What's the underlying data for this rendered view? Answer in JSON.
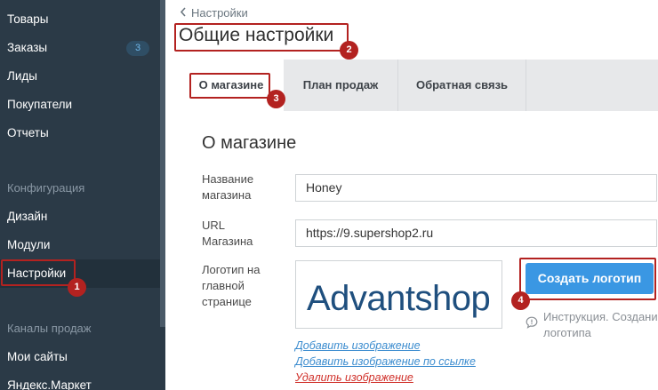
{
  "sidebar": {
    "items": [
      {
        "label": "Товары"
      },
      {
        "label": "Заказы",
        "badge": "3"
      },
      {
        "label": "Лиды"
      },
      {
        "label": "Покупатели"
      },
      {
        "label": "Отчеты"
      }
    ],
    "config_group": "Конфигурация",
    "config_items": [
      {
        "label": "Дизайн"
      },
      {
        "label": "Модули"
      },
      {
        "label": "Настройки",
        "active": true
      }
    ],
    "channels_group": "Каналы продаж",
    "channel_items": [
      {
        "label": "Мои сайты"
      },
      {
        "label": "Яндекс.Маркет"
      }
    ]
  },
  "header": {
    "breadcrumb": "Настройки",
    "title": "Общие настройки"
  },
  "tabs": [
    {
      "label": "О магазине",
      "active": true
    },
    {
      "label": "План продаж"
    },
    {
      "label": "Обратная связь"
    }
  ],
  "form": {
    "section_title": "О магазине",
    "store_name_label": "Название магазина",
    "store_name_value": "Honey",
    "url_label": "URL Магазина",
    "url_value": "https://9.supershop2.ru",
    "logo_label": "Логотип на главной странице",
    "logo_text": "Advantshop",
    "add_image_link": "Добавить изображение",
    "add_image_url_link": "Добавить изображение по ссылке",
    "delete_image_link": "Удалить изображение",
    "create_logo_button": "Создать логотип",
    "help_text_line1": "Инструкция. Создани",
    "help_text_line2": "логотипа"
  },
  "annotations": {
    "m1": "1",
    "m2": "2",
    "m3": "3",
    "m4": "4"
  },
  "colors": {
    "sidebar_bg": "#2b3a47",
    "accent": "#3a97e3",
    "highlight": "#b32220",
    "logo_blue": "#1f4f7e"
  }
}
